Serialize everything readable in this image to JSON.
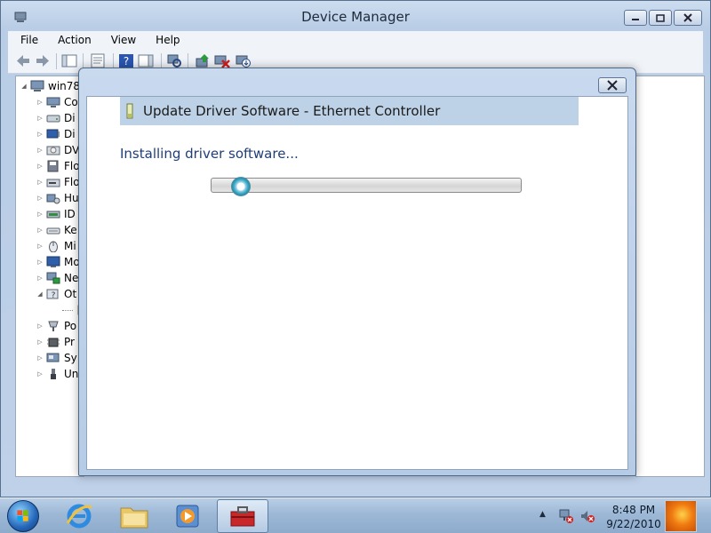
{
  "window": {
    "title": "Device Manager",
    "menu": [
      "File",
      "Action",
      "View",
      "Help"
    ]
  },
  "tree": {
    "root": "win78",
    "items": [
      {
        "label": "Co",
        "expand": "collapsed",
        "icon": "computer-icon"
      },
      {
        "label": "Di",
        "expand": "collapsed",
        "icon": "disk-drive-icon"
      },
      {
        "label": "Di",
        "expand": "collapsed",
        "icon": "display-adapter-icon"
      },
      {
        "label": "DV",
        "expand": "collapsed",
        "icon": "dvd-drive-icon"
      },
      {
        "label": "Flo",
        "expand": "collapsed",
        "icon": "floppy-controller-icon"
      },
      {
        "label": "Flo",
        "expand": "collapsed",
        "icon": "floppy-drive-icon"
      },
      {
        "label": "Hu",
        "expand": "collapsed",
        "icon": "hid-icon"
      },
      {
        "label": "ID",
        "expand": "collapsed",
        "icon": "ide-controller-icon"
      },
      {
        "label": "Ke",
        "expand": "collapsed",
        "icon": "keyboard-icon"
      },
      {
        "label": "Mi",
        "expand": "collapsed",
        "icon": "mouse-icon"
      },
      {
        "label": "Mo",
        "expand": "collapsed",
        "icon": "monitor-icon"
      },
      {
        "label": "Ne",
        "expand": "collapsed",
        "icon": "network-adapter-icon"
      },
      {
        "label": "Ot",
        "expand": "expanded",
        "icon": "other-devices-icon"
      },
      {
        "label": "",
        "expand": "child",
        "icon": "unknown-device-warning-icon"
      },
      {
        "label": "Po",
        "expand": "collapsed",
        "icon": "ports-icon"
      },
      {
        "label": "Pr",
        "expand": "collapsed",
        "icon": "processor-icon"
      },
      {
        "label": "Sy",
        "expand": "collapsed",
        "icon": "system-devices-icon"
      },
      {
        "label": "Un",
        "expand": "collapsed",
        "icon": "usb-controller-icon"
      }
    ]
  },
  "dialog": {
    "header": "Update Driver Software - Ethernet Controller",
    "status": "Installing driver software..."
  },
  "taskbar": {
    "clock_time": "8:48 PM",
    "clock_date": "9/22/2010"
  },
  "colors": {
    "status_text": "#1f3e78",
    "header_band": "#bdd1e7"
  }
}
